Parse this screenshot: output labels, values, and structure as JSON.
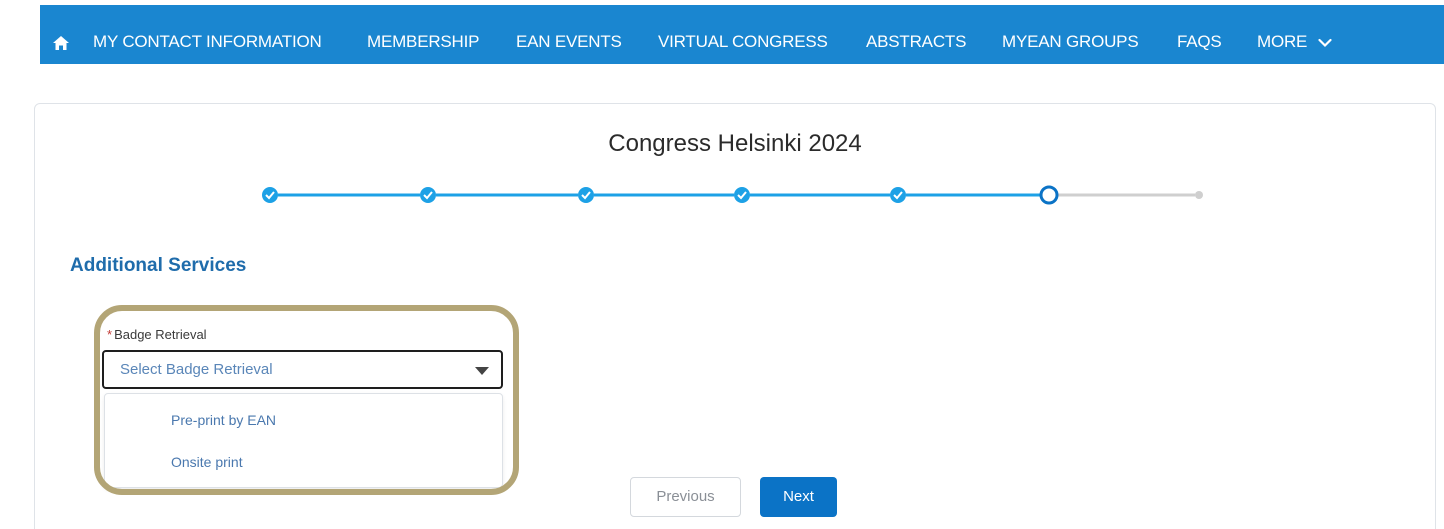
{
  "nav": {
    "items": [
      {
        "label": "MY CONTACT INFORMATION"
      },
      {
        "label": "MEMBERSHIP"
      },
      {
        "label": "EAN EVENTS"
      },
      {
        "label": "VIRTUAL CONGRESS"
      },
      {
        "label": "ABSTRACTS"
      },
      {
        "label": "MYEAN GROUPS"
      },
      {
        "label": "FAQS"
      },
      {
        "label": "MORE"
      }
    ],
    "home_icon": "home-icon",
    "more_icon": "chevron-down-icon"
  },
  "page": {
    "title": "Congress Helsinki 2024",
    "section_title": "Additional Services"
  },
  "stepper": {
    "total_steps": 7,
    "completed_steps": 5,
    "current_step": 6
  },
  "form": {
    "badge_label": "Badge Retrieval",
    "required_marker": "*",
    "select_placeholder": "Select Badge Retrieval",
    "options": [
      "Pre-print by EAN",
      "Onsite print"
    ]
  },
  "buttons": {
    "previous": "Previous",
    "next": "Next"
  },
  "colors": {
    "nav_bg": "#1a86d0",
    "step_active": "#1da1e6",
    "step_inactive": "#cfcfcf",
    "next_button": "#0b73c6",
    "highlight": "#b3a576"
  }
}
